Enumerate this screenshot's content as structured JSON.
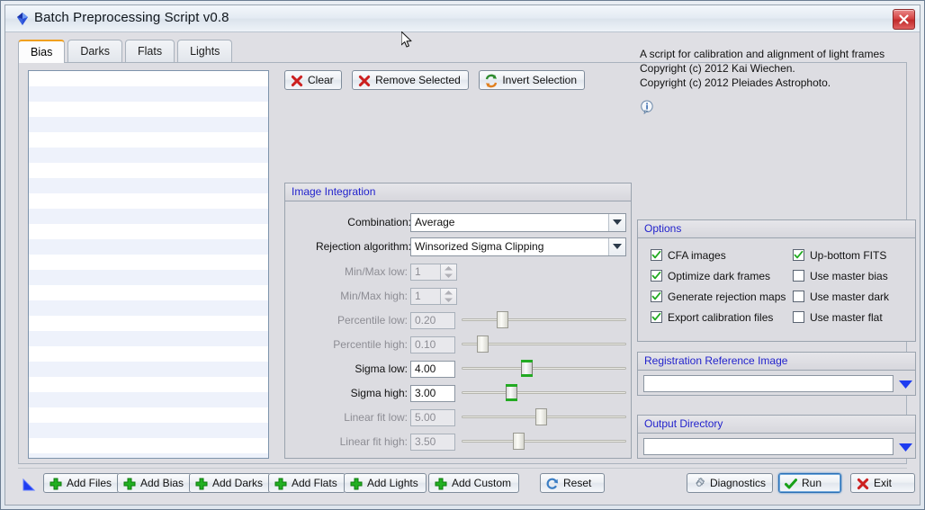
{
  "window": {
    "title": "Batch Preprocessing Script v0.8",
    "app_icon": "gem-icon",
    "close_label": "close-icon"
  },
  "tabs": [
    {
      "label": "Bias",
      "active": true
    },
    {
      "label": "Darks",
      "active": false
    },
    {
      "label": "Flats",
      "active": false
    },
    {
      "label": "Lights",
      "active": false
    }
  ],
  "toolbar": {
    "clear_label": "Clear",
    "remove_selected_label": "Remove Selected",
    "invert_selection_label": "Invert Selection"
  },
  "info": {
    "line1": "A script for calibration and alignment of light frames",
    "line2": "Copyright (c) 2012 Kai Wiechen.",
    "line3": "Copyright (c) 2012 Pleiades Astrophoto.",
    "icon": "info-icon"
  },
  "integration": {
    "title": "Image Integration",
    "combination": {
      "label": "Combination:",
      "value": "Average",
      "enabled": true
    },
    "rejection": {
      "label": "Rejection algorithm:",
      "value": "Winsorized Sigma Clipping",
      "enabled": true
    },
    "fields": [
      {
        "label": "Min/Max low:",
        "value": "1",
        "enabled": false,
        "widget": "spinner"
      },
      {
        "label": "Min/Max high:",
        "value": "1",
        "enabled": false,
        "widget": "spinner"
      },
      {
        "label": "Percentile low:",
        "value": "0.20",
        "enabled": false,
        "widget": "slider",
        "knob_pct": 23
      },
      {
        "label": "Percentile high:",
        "value": "0.10",
        "enabled": false,
        "widget": "slider",
        "knob_pct": 10
      },
      {
        "label": "Sigma low:",
        "value": "4.00",
        "enabled": true,
        "widget": "slider",
        "knob_pct": 39
      },
      {
        "label": "Sigma high:",
        "value": "3.00",
        "enabled": true,
        "widget": "slider",
        "knob_pct": 29
      },
      {
        "label": "Linear fit low:",
        "value": "5.00",
        "enabled": false,
        "widget": "slider",
        "knob_pct": 49
      },
      {
        "label": "Linear fit high:",
        "value": "3.50",
        "enabled": false,
        "widget": "slider",
        "knob_pct": 34
      }
    ]
  },
  "options": {
    "title": "Options",
    "left_column": [
      {
        "label": "CFA images",
        "checked": true
      },
      {
        "label": "Optimize dark frames",
        "checked": true
      },
      {
        "label": "Generate rejection maps",
        "checked": true
      },
      {
        "label": "Export calibration files",
        "checked": true
      }
    ],
    "right_column": [
      {
        "label": "Up-bottom FITS",
        "checked": true
      },
      {
        "label": "Use master bias",
        "checked": false
      },
      {
        "label": "Use master dark",
        "checked": false
      },
      {
        "label": "Use master flat",
        "checked": false
      }
    ]
  },
  "registration_reference": {
    "title": "Registration Reference Image",
    "value": ""
  },
  "output_directory": {
    "title": "Output Directory",
    "value": ""
  },
  "bottom_bar": {
    "add_files": "Add Files",
    "add_bias": "Add Bias",
    "add_darks": "Add Darks",
    "add_flats": "Add Flats",
    "add_lights": "Add Lights",
    "add_custom": "Add Custom",
    "reset": "Reset",
    "diagnostics": "Diagnostics",
    "run": "Run",
    "exit": "Exit"
  },
  "colors": {
    "group_title": "#2222cc",
    "accent_tab": "#f0a020",
    "check_green": "#22aa22",
    "close_red": "#c02a2a",
    "list_alt_row": "#eef2fb"
  }
}
